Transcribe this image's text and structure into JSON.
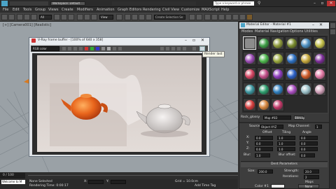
{
  "app": {
    "title": "Workspace: Default",
    "search_placeholder": "Type a keyword or phrase"
  },
  "menus": [
    "File",
    "Edit",
    "Tools",
    "Group",
    "Views",
    "Create",
    "Modifiers",
    "Animation",
    "Graph Editors",
    "Rendering",
    "Civil View",
    "Customize",
    "MAXScript",
    "Help"
  ],
  "toolbar": {
    "view_dropdown": "View",
    "selection_dropdown": "Create Selection Se"
  },
  "viewport": {
    "label": "[+] [Camera001] [Realistic]"
  },
  "vfb": {
    "title": "V-Ray frame buffer - [100% of 640 x 358]",
    "channel": "RGB color",
    "tooltip": "Render last"
  },
  "material_editor": {
    "title": "Material Editor - Material #1",
    "menu": [
      "Modes",
      "Material",
      "Navigation",
      "Options",
      "Utilities"
    ],
    "name_prefix": "Rock_glossy",
    "map_field": "Map #83",
    "bitmap_label": "Bitmap",
    "source_label": "Source:",
    "source_value": "Object XYZ",
    "map_channel_label": "Map Channel:",
    "map_channel_value": "1",
    "offset_label": "Offset",
    "tiling_label": "Tiling",
    "angle_label": "Angle",
    "x_label": "X:",
    "y_label": "Y:",
    "z_label": "Z:",
    "offset_x": "0.0",
    "offset_y": "0.0",
    "offset_z": "0.0",
    "tiling_x": "1.0",
    "tiling_y": "1.0",
    "tiling_z": "1.0",
    "angle_x": "0.0",
    "angle_y": "0.0",
    "angle_z": "0.0",
    "blur_label": "Blur:",
    "blur_value": "1.0",
    "blur_offset_label": "Blur offset:",
    "blur_offset_value": "0.0",
    "dent_params": "Dent Parameters",
    "size_label": "Size:",
    "size_value": "200.0",
    "strength_label": "Strength:",
    "strength_value": "20.0",
    "iterations_label": "Iterations:",
    "iterations_value": "2",
    "maps_label": "Maps",
    "swap_label": "Swap",
    "color1_label": "Color #1",
    "color2_label": "Color #2",
    "none_label": "None"
  },
  "sample_colors": [
    "#8c8c8c",
    "#3f9f47",
    "#8e9a3c",
    "#7a8c2f",
    "#4d8fc0",
    "#c3c04a",
    "#9c4cb5",
    "#4fb84e",
    "#9aa83d",
    "#2f72c3",
    "#c7a93d",
    "#7e2f9a",
    "#d64663",
    "#c3508a",
    "#8e3dbd",
    "#2d62c8",
    "#d05c2a",
    "#e27aa5",
    "#3e97a0",
    "#2f9f6f",
    "#2f7fbf",
    "#aa4fc0",
    "#9bc0c8",
    "#d0a0b8",
    "#d63f3f",
    "#d68740",
    "#c33a6a"
  ],
  "timeline": {
    "frame": "0 / 100"
  },
  "status": {
    "selected": "None Selected",
    "welcome": "Welcome to M",
    "rendering_time": "Rendering Time: 0:00:17",
    "add_time_tag": "Add Time Tag",
    "x_label": "X:",
    "y_label": "Y:",
    "grid_label": "Grid = 10.0cm"
  }
}
